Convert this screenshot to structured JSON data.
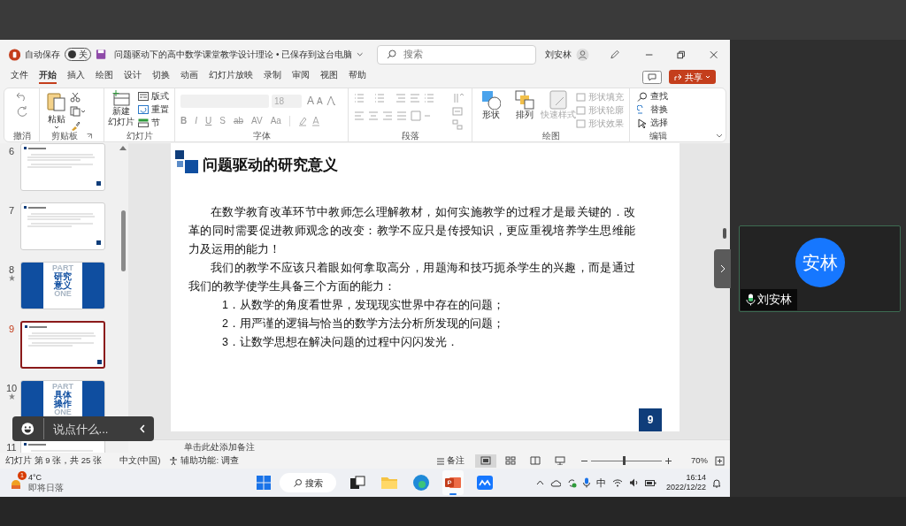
{
  "title_bar": {
    "autosave_label": "自动保存",
    "autosave": {
      "on": false,
      "label": "关"
    },
    "doc_title": "问题驱动下的高中数学课堂教学设计理论 • 已保存到这台电脑",
    "search_placeholder": "搜索",
    "user_name": "刘安林"
  },
  "menu_tabs": [
    {
      "label": "文件",
      "selected": false
    },
    {
      "label": "开始",
      "selected": true
    },
    {
      "label": "插入",
      "selected": false
    },
    {
      "label": "绘图",
      "selected": false
    },
    {
      "label": "设计",
      "selected": false
    },
    {
      "label": "切换",
      "selected": false
    },
    {
      "label": "动画",
      "selected": false
    },
    {
      "label": "幻灯片放映",
      "selected": false
    },
    {
      "label": "录制",
      "selected": false
    },
    {
      "label": "审阅",
      "selected": false
    },
    {
      "label": "视图",
      "selected": false
    },
    {
      "label": "帮助",
      "selected": false
    }
  ],
  "share_button": "共享",
  "ribbon": {
    "undo": {
      "label": "撤消"
    },
    "clipboard": {
      "label": "剪贴板",
      "paste": "粘贴"
    },
    "slides": {
      "label": "幻灯片",
      "new_slide": [
        "新建",
        "幻灯片"
      ],
      "layout": "版式",
      "reset": "重置",
      "section": "节"
    },
    "font": {
      "label": "字体",
      "size": "18",
      "grow": "A",
      "shrink": "A",
      "buttons": [
        "B",
        "I",
        "U",
        "S",
        "ab",
        "AV",
        "Aa"
      ]
    },
    "paragraph": {
      "label": "段落"
    },
    "drawing": {
      "label": "绘图",
      "items": [
        {
          "kind": "large",
          "label": "形状",
          "disabled": false
        },
        {
          "kind": "large",
          "label": "排列",
          "disabled": false
        },
        {
          "kind": "large",
          "label": "快速样式",
          "disabled": true
        },
        {
          "kind": "small",
          "label": "形状填充",
          "disabled": true
        },
        {
          "kind": "small",
          "label": "形状轮廓",
          "disabled": true
        },
        {
          "kind": "small",
          "label": "形状效果",
          "disabled": true
        }
      ]
    },
    "editing": {
      "label": "编辑",
      "items": [
        "查找",
        "替换",
        "选择"
      ]
    }
  },
  "thumbnails": [
    {
      "number": "6",
      "kind": "text",
      "selected": false,
      "animated": false
    },
    {
      "number": "7",
      "kind": "text",
      "selected": false,
      "animated": false
    },
    {
      "number": "8",
      "kind": "section",
      "title": "研究意义",
      "watermark_top": "PART",
      "watermark_bottom": "ONE",
      "selected": false,
      "animated": true
    },
    {
      "number": "9",
      "kind": "text",
      "selected": true,
      "animated": false
    },
    {
      "number": "10",
      "kind": "section",
      "title": "具体操作",
      "watermark_top": "PART",
      "watermark_bottom": "ONE",
      "selected": false,
      "animated": true
    },
    {
      "number": "11",
      "kind": "text",
      "selected": false,
      "animated": false
    }
  ],
  "slide": {
    "title": "问题驱动的研究意义",
    "page_number": "9",
    "blocks": [
      {
        "kind": "para",
        "text": "在数学教育改革环节中教师怎么理解教材，如何实施教学的过程才是最关键的．改革的同时需要促进教师观念的改变：教学不应只是传授知识，更应重视培养学生思维能力及运用的能力！"
      },
      {
        "kind": "para",
        "text": "我们的教学不应该只着眼如何拿取高分，用题海和技巧扼杀学生的兴趣，而是通过我们的教学使学生具备三个方面的能力："
      },
      {
        "kind": "list",
        "text": "1．从数学的角度看世界，发现现实世界中存在的问题；"
      },
      {
        "kind": "list",
        "text": "2．用严谨的逻辑与恰当的数学方法分析所发现的问题；"
      },
      {
        "kind": "list",
        "text": "3．让数学思想在解决问题的过程中闪闪发光．"
      }
    ]
  },
  "notes_placeholder": "单击此处添加备注",
  "chat_overlay": {
    "placeholder": "说点什么..."
  },
  "status_bar": {
    "slide_info": "幻灯片 第 9 张，共 25 张",
    "language": "中文(中国)",
    "accessibility": "辅助功能: 调查",
    "notes_button": "备注",
    "views": [
      {
        "selected": true
      },
      {
        "selected": false
      },
      {
        "selected": false
      },
      {
        "selected": false
      }
    ],
    "zoom": {
      "level": 0.47,
      "reading": "70%"
    }
  },
  "taskbar": {
    "weather": {
      "badge": "1",
      "temp": "4°C",
      "desc": "即将日落"
    },
    "search": "搜索",
    "apps": [
      {
        "kind": "taskview",
        "active": false
      },
      {
        "kind": "folder",
        "active": false
      },
      {
        "kind": "browser",
        "active": false
      },
      {
        "kind": "slides",
        "active": true
      },
      {
        "kind": "meeting",
        "active": false
      }
    ],
    "ime": "中",
    "time": "16:14",
    "date": "2022/12/22"
  },
  "video_tile": {
    "avatar_text": "安林",
    "name": "刘安林"
  }
}
